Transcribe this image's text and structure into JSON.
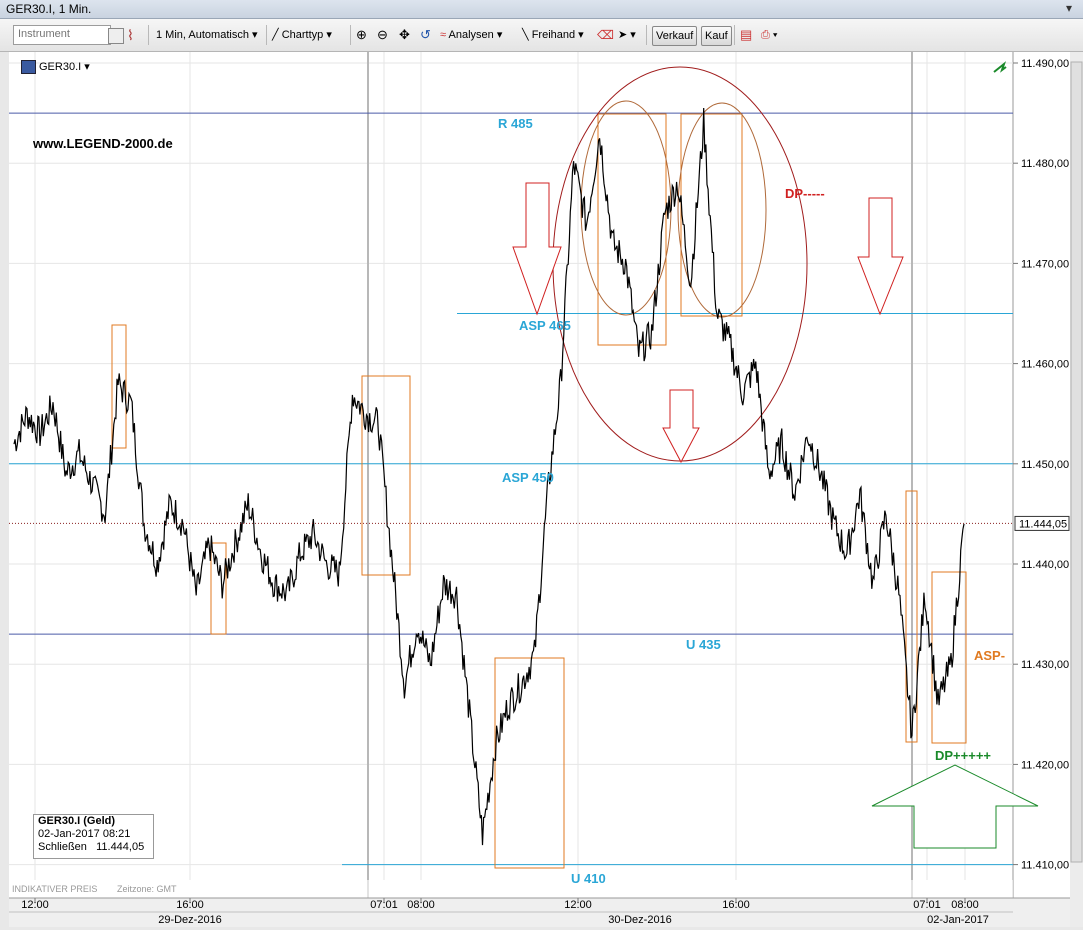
{
  "window": {
    "title": "GER30.I, 1 Min."
  },
  "toolbar": {
    "instrument_placeholder": "Instrument",
    "interval_label": "1 Min,  Automatisch",
    "charttyp_label": "Charttyp",
    "analysen_label": "Analysen",
    "freihand_label": "Freihand",
    "verkauf_label": "Verkauf",
    "kauf_label": "Kauf"
  },
  "chart": {
    "symbol": "GER30.I",
    "website": "www.LEGEND-2000.de",
    "footer_left": "INDIKATIVER PREIS",
    "footer_timezone": "Zeitzone: GMT",
    "current_price_label": "11.444,05",
    "annotations": {
      "r485": "R 485",
      "asp465": "ASP 465",
      "asp450": "ASP 450",
      "u435": "U 435",
      "u410": "U 410",
      "dp_minus": "DP-----",
      "dp_plus": "DP+++++",
      "asp_minus": "ASP-"
    },
    "info": {
      "name": "GER30.I (Geld)",
      "datetime": "02-Jan-2017 08:21",
      "close_label": "Schließen",
      "close_value": "11.444,05"
    }
  },
  "chart_data": {
    "type": "line",
    "series": [
      {
        "name": "GER30.I",
        "values": [
          11452,
          11455,
          11453,
          11456,
          11449,
          11451,
          11448,
          11445,
          11458,
          11456,
          11444,
          11440,
          11446,
          11444,
          11437,
          11442,
          11438,
          11442,
          11446,
          11441,
          11438,
          11437,
          11441,
          11443,
          11440,
          11439,
          11457,
          11455,
          11454,
          11441,
          11428,
          11434,
          11430,
          11438,
          11437,
          11425,
          11413,
          11422,
          11426,
          11428,
          11431,
          11447,
          11458,
          11480,
          11474,
          11483,
          11472,
          11470,
          11461,
          11463,
          11475,
          11478,
          11468,
          11484,
          11465,
          11462,
          11457,
          11460,
          11449,
          11452,
          11447,
          11453,
          11449,
          11444,
          11441,
          11447,
          11438,
          11445,
          11437,
          11423,
          11437,
          11426,
          11430,
          11444
        ]
      }
    ],
    "x_tick_labels": [
      "12:00",
      "16:00",
      "07:01",
      "08:00",
      "12:00",
      "16:00",
      "07:01",
      "08:00"
    ],
    "date_labels": [
      "29-Dez-2016",
      "30-Dez-2016",
      "02-Jan-2017"
    ],
    "y_tick_labels": [
      "11.490,00",
      "11.480,00",
      "11.470,00",
      "11.460,00",
      "11.450,00",
      "11.440,00",
      "11.430,00",
      "11.420,00",
      "11.410,00"
    ],
    "ylim": [
      11410,
      11490
    ],
    "horizontal_levels": [
      11485,
      11465,
      11450,
      11433,
      11410
    ],
    "last_price": 11444.05,
    "colors": {
      "price": "#000000",
      "level_blue": "#2aa6d6",
      "level_dark": "#4a5aa8",
      "box": "#e07a20",
      "ellipse": "#a01c1c",
      "arrow_red": "#d02020",
      "arrow_green": "#1a8a2a"
    }
  }
}
